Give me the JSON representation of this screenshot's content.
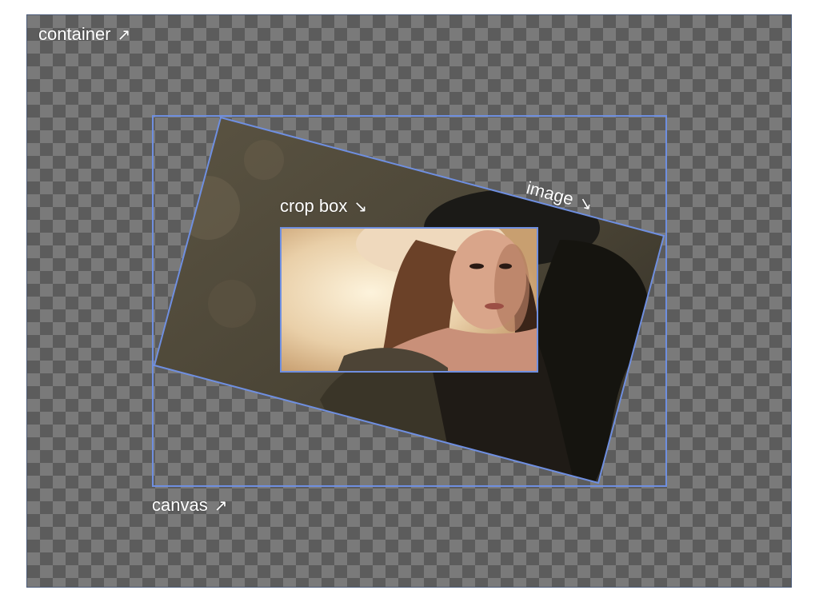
{
  "labels": {
    "container": "container",
    "canvas": "canvas",
    "image": "image",
    "crop_box": "crop box"
  },
  "arrows": {
    "container": "↗",
    "canvas": "↗",
    "image": "↘",
    "crop_box": "↘"
  },
  "colors": {
    "outline": "#6f8fe0",
    "container_border": "#4a5a78",
    "checker_light": "#7a7a7a",
    "checker_dark": "#5c5c5c",
    "label_text": "#ffffff"
  },
  "icons": [
    "arrow-up-right-icon",
    "arrow-down-right-icon"
  ]
}
